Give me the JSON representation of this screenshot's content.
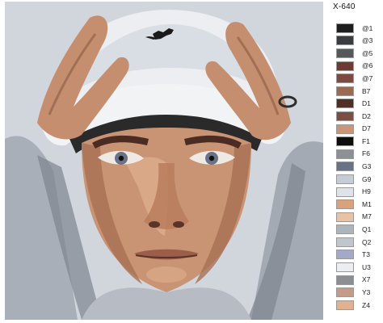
{
  "product": {
    "code": "X-640",
    "artwork_subject": "portrait"
  },
  "palette": [
    {
      "label": "@1",
      "color": "#1e1e1e"
    },
    {
      "label": "@3",
      "color": "#3a3d40"
    },
    {
      "label": "@5",
      "color": "#55595c"
    },
    {
      "label": "@6",
      "color": "#6b3b34"
    },
    {
      "label": "@7",
      "color": "#7d4a40"
    },
    {
      "label": "B7",
      "color": "#9a6a52"
    },
    {
      "label": "D1",
      "color": "#4e2e25"
    },
    {
      "label": "D2",
      "color": "#7a4e42"
    },
    {
      "label": "D7",
      "color": "#c9967a"
    },
    {
      "label": "F1",
      "color": "#0e0e0e"
    },
    {
      "label": "F6",
      "color": "#8d9096"
    },
    {
      "label": "G3",
      "color": "#6a7286"
    },
    {
      "label": "G9",
      "color": "#c5ccd6"
    },
    {
      "label": "H9",
      "color": "#dfe3e8"
    },
    {
      "label": "M1",
      "color": "#d9a27c"
    },
    {
      "label": "M7",
      "color": "#e7c2a6"
    },
    {
      "label": "Q1",
      "color": "#aeb4bb"
    },
    {
      "label": "Q2",
      "color": "#c1c6cd"
    },
    {
      "label": "T3",
      "color": "#a3a9c7"
    },
    {
      "label": "U3",
      "color": "#ecedf0"
    },
    {
      "label": "X7",
      "color": "#8c8f92"
    },
    {
      "label": "Y3",
      "color": "#c49b88"
    },
    {
      "label": "Z4",
      "color": "#e3b090"
    }
  ]
}
